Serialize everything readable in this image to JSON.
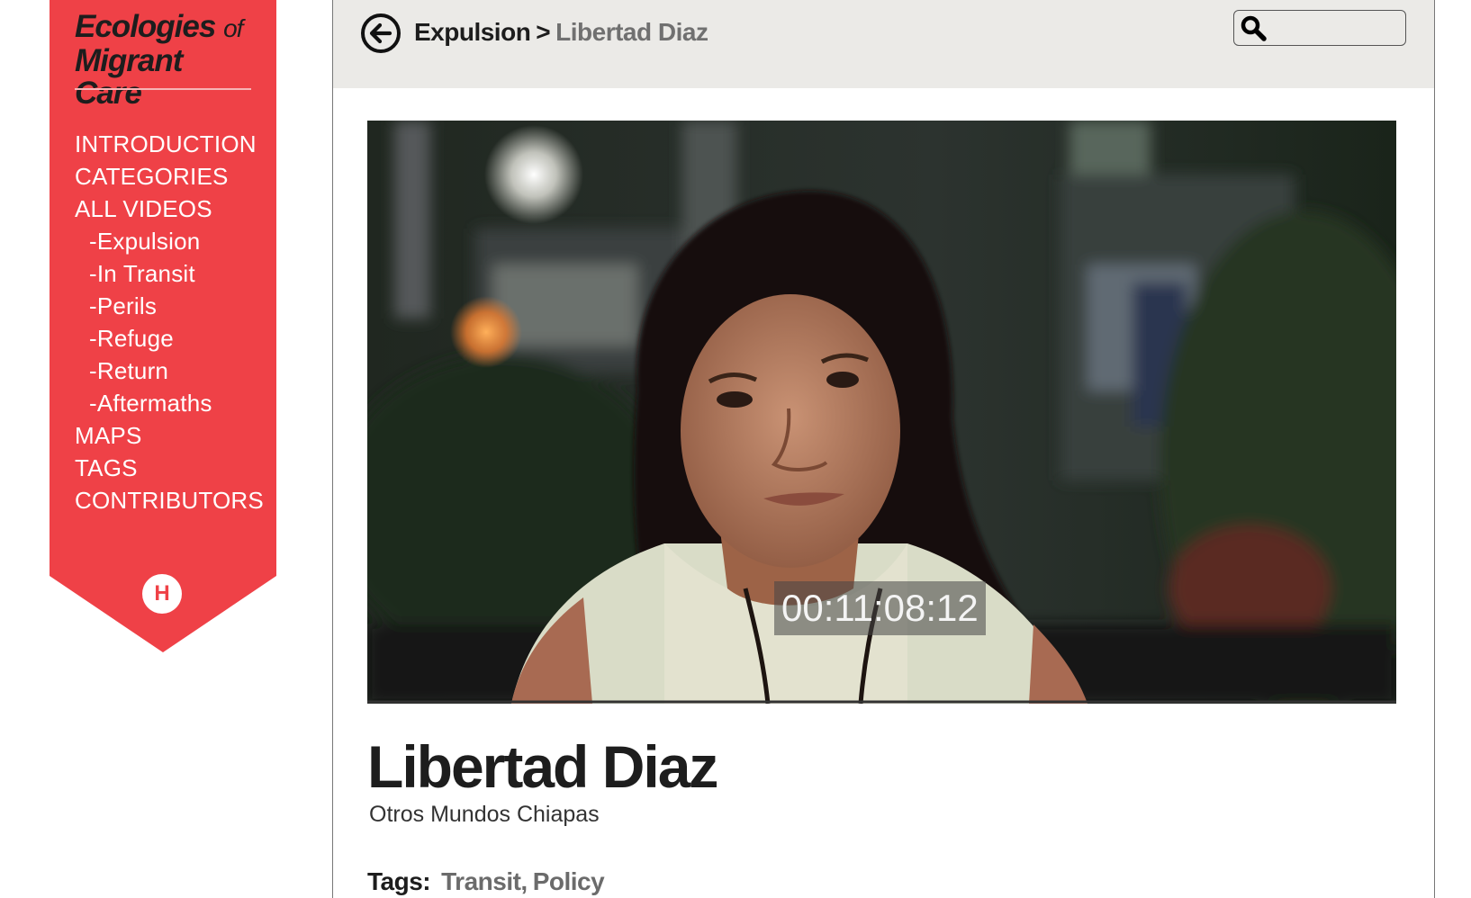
{
  "brand": {
    "line1": "Ecologies",
    "of": "of",
    "line2": "Migrant Care"
  },
  "nav": {
    "items": [
      {
        "label": "INTRODUCTION"
      },
      {
        "label": "CATEGORIES"
      },
      {
        "label": "ALL VIDEOS"
      },
      {
        "label": "-Expulsion"
      },
      {
        "label": "-In Transit"
      },
      {
        "label": "-Perils"
      },
      {
        "label": "-Refuge"
      },
      {
        "label": "-Return"
      },
      {
        "label": "-Aftermaths"
      },
      {
        "label": "MAPS"
      },
      {
        "label": "TAGS"
      },
      {
        "label": "CONTRIBUTORS"
      }
    ],
    "logo_letter": "H"
  },
  "breadcrumb": {
    "parent": "Expulsion",
    "separator": ">",
    "current": "Libertad Diaz"
  },
  "search": {
    "placeholder": "",
    "value": ""
  },
  "video": {
    "timecode": "00:11:08:12"
  },
  "entry": {
    "title": "Libertad Diaz",
    "subtitle": "Otros Mundos Chiapas",
    "tags_label": "Tags:",
    "tags": [
      "Transit",
      "Policy"
    ]
  },
  "colors": {
    "sidebar": "#ef4147",
    "topbar": "#ebeae7",
    "text_dark": "#1d1d1d",
    "text_muted": "#707070"
  },
  "icons": {
    "back": "arrow-left-circle-icon",
    "search": "magnifier-icon",
    "logo": "h-circle-logo"
  }
}
